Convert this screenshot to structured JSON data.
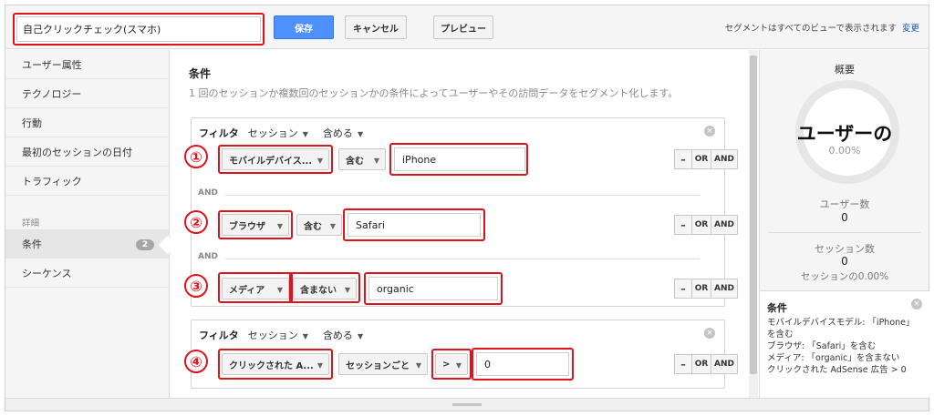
{
  "header": {
    "segment_name": "自己クリックチェック(スマホ)",
    "save_label": "保存",
    "cancel_label": "キャンセル",
    "preview_label": "プレビュー",
    "note": "セグメントはすべてのビューで表示されます",
    "change_link": "変更"
  },
  "sidebar": {
    "items": [
      {
        "label": "ユーザー属性"
      },
      {
        "label": "テクノロジー"
      },
      {
        "label": "行動"
      },
      {
        "label": "最初のセッションの日付"
      },
      {
        "label": "トラフィック"
      }
    ],
    "advanced_label": "詳細",
    "advanced_items": [
      {
        "label": "条件",
        "badge": "2"
      },
      {
        "label": "シーケンス"
      }
    ]
  },
  "main": {
    "title": "条件",
    "description": "1 回のセッションか複数回のセッションかの条件によってユーザーやその訪問データをセグメント化します。",
    "filters": [
      {
        "label": "フィルタ",
        "scope": "セッション",
        "mode": "含める",
        "rows": [
          {
            "number": "①",
            "dimension": "モバイルデバイス...",
            "operator": "含む",
            "value": "iPhone"
          },
          {
            "number": "②",
            "dimension": "ブラウザ",
            "operator": "含む",
            "value": "Safari"
          },
          {
            "number": "③",
            "dimension": "メディア",
            "operator": "含まない",
            "value": "organic"
          }
        ]
      },
      {
        "label": "フィルタ",
        "scope": "セッション",
        "mode": "含める",
        "rows": [
          {
            "number": "④",
            "dimension": "クリックされた A...",
            "per": "セッションごと",
            "operator": ">",
            "value": "0"
          }
        ]
      }
    ],
    "and_label": "AND",
    "op_minus": "–",
    "op_or": "OR",
    "op_and": "AND"
  },
  "summary": {
    "title": "概要",
    "big_text": "ユーザーの",
    "percent": "0.00%",
    "users_label": "ユーザー数",
    "users_value": "0",
    "sessions_label": "セッション数",
    "sessions_value": "0",
    "sessions_pct": "セッションの0.00%",
    "conditions_title": "条件",
    "conditions": [
      "モバイルデバイスモデル: 「iPhone」を含む",
      "ブラウザ: 「Safari」を含む",
      "メディア: 「organic」を含まない",
      "クリックされた AdSense 広告 > 0"
    ]
  },
  "colors": {
    "accent": "#4d90fe",
    "highlight": "#e0121a",
    "link": "#1a5fb4"
  }
}
